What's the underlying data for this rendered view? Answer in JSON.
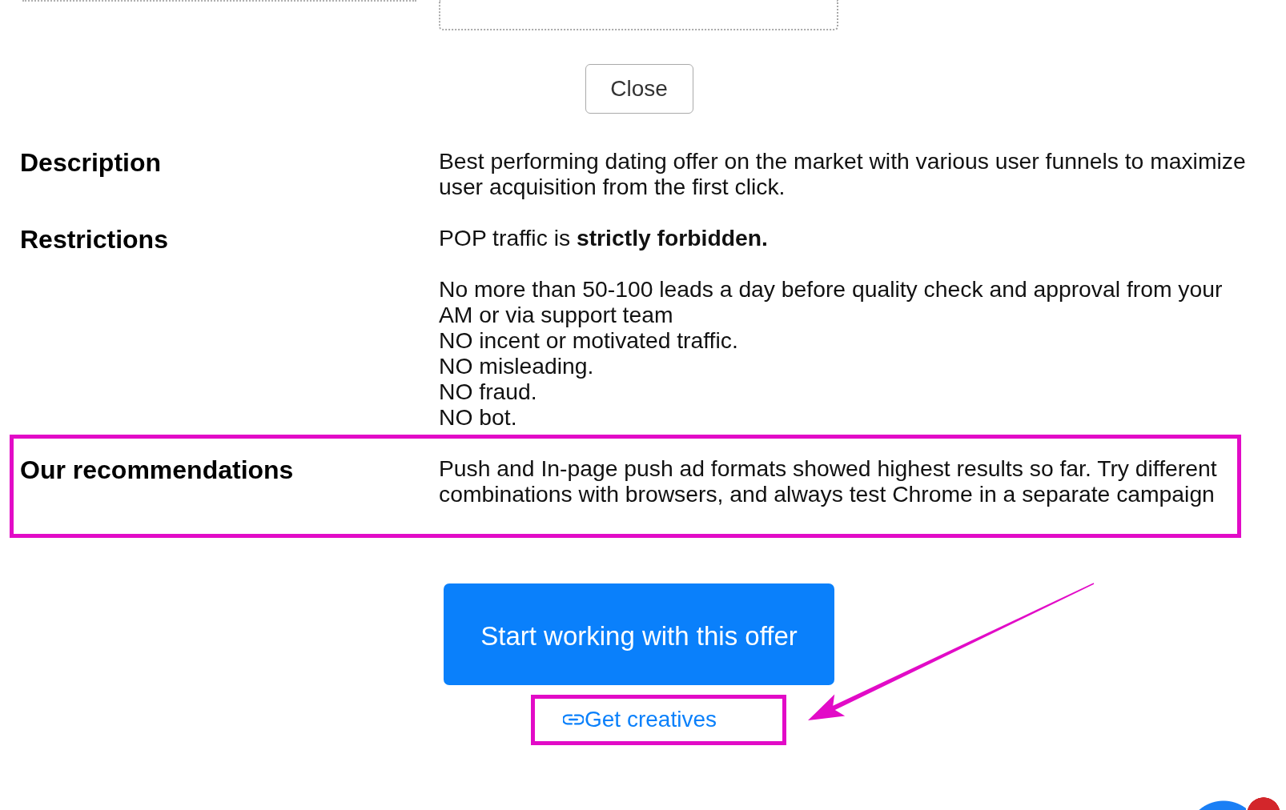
{
  "close_button": {
    "label": "Close"
  },
  "sections": [
    {
      "label": "Description",
      "highlighted": false,
      "paragraphs": [
        [
          "Best performing dating offer on the market with various user funnels to maximize user acquisition from the first click."
        ]
      ]
    },
    {
      "label": "Restrictions",
      "highlighted": false,
      "paragraphs": [
        [
          "POP traffic is **strictly forbidden.**"
        ],
        [
          "No more than 50-100 leads a day before quality check and approval from your AM or via support team",
          "NO incent or motivated traffic.",
          "NO misleading.",
          "NO fraud.",
          "NO bot."
        ]
      ]
    },
    {
      "label": "Our recommendations",
      "highlighted": true,
      "paragraphs": [
        [
          "Push and In-page push ad formats showed highest results so far. Try different combinations with browsers, and always test Chrome in a separate campaign"
        ]
      ]
    }
  ],
  "primary_button": {
    "label": "Start working with this offer"
  },
  "creatives_link": {
    "label": "Get creatives",
    "highlighted": true,
    "pointer_arrow": true
  },
  "chat_button": {
    "unread_badge": true
  }
}
